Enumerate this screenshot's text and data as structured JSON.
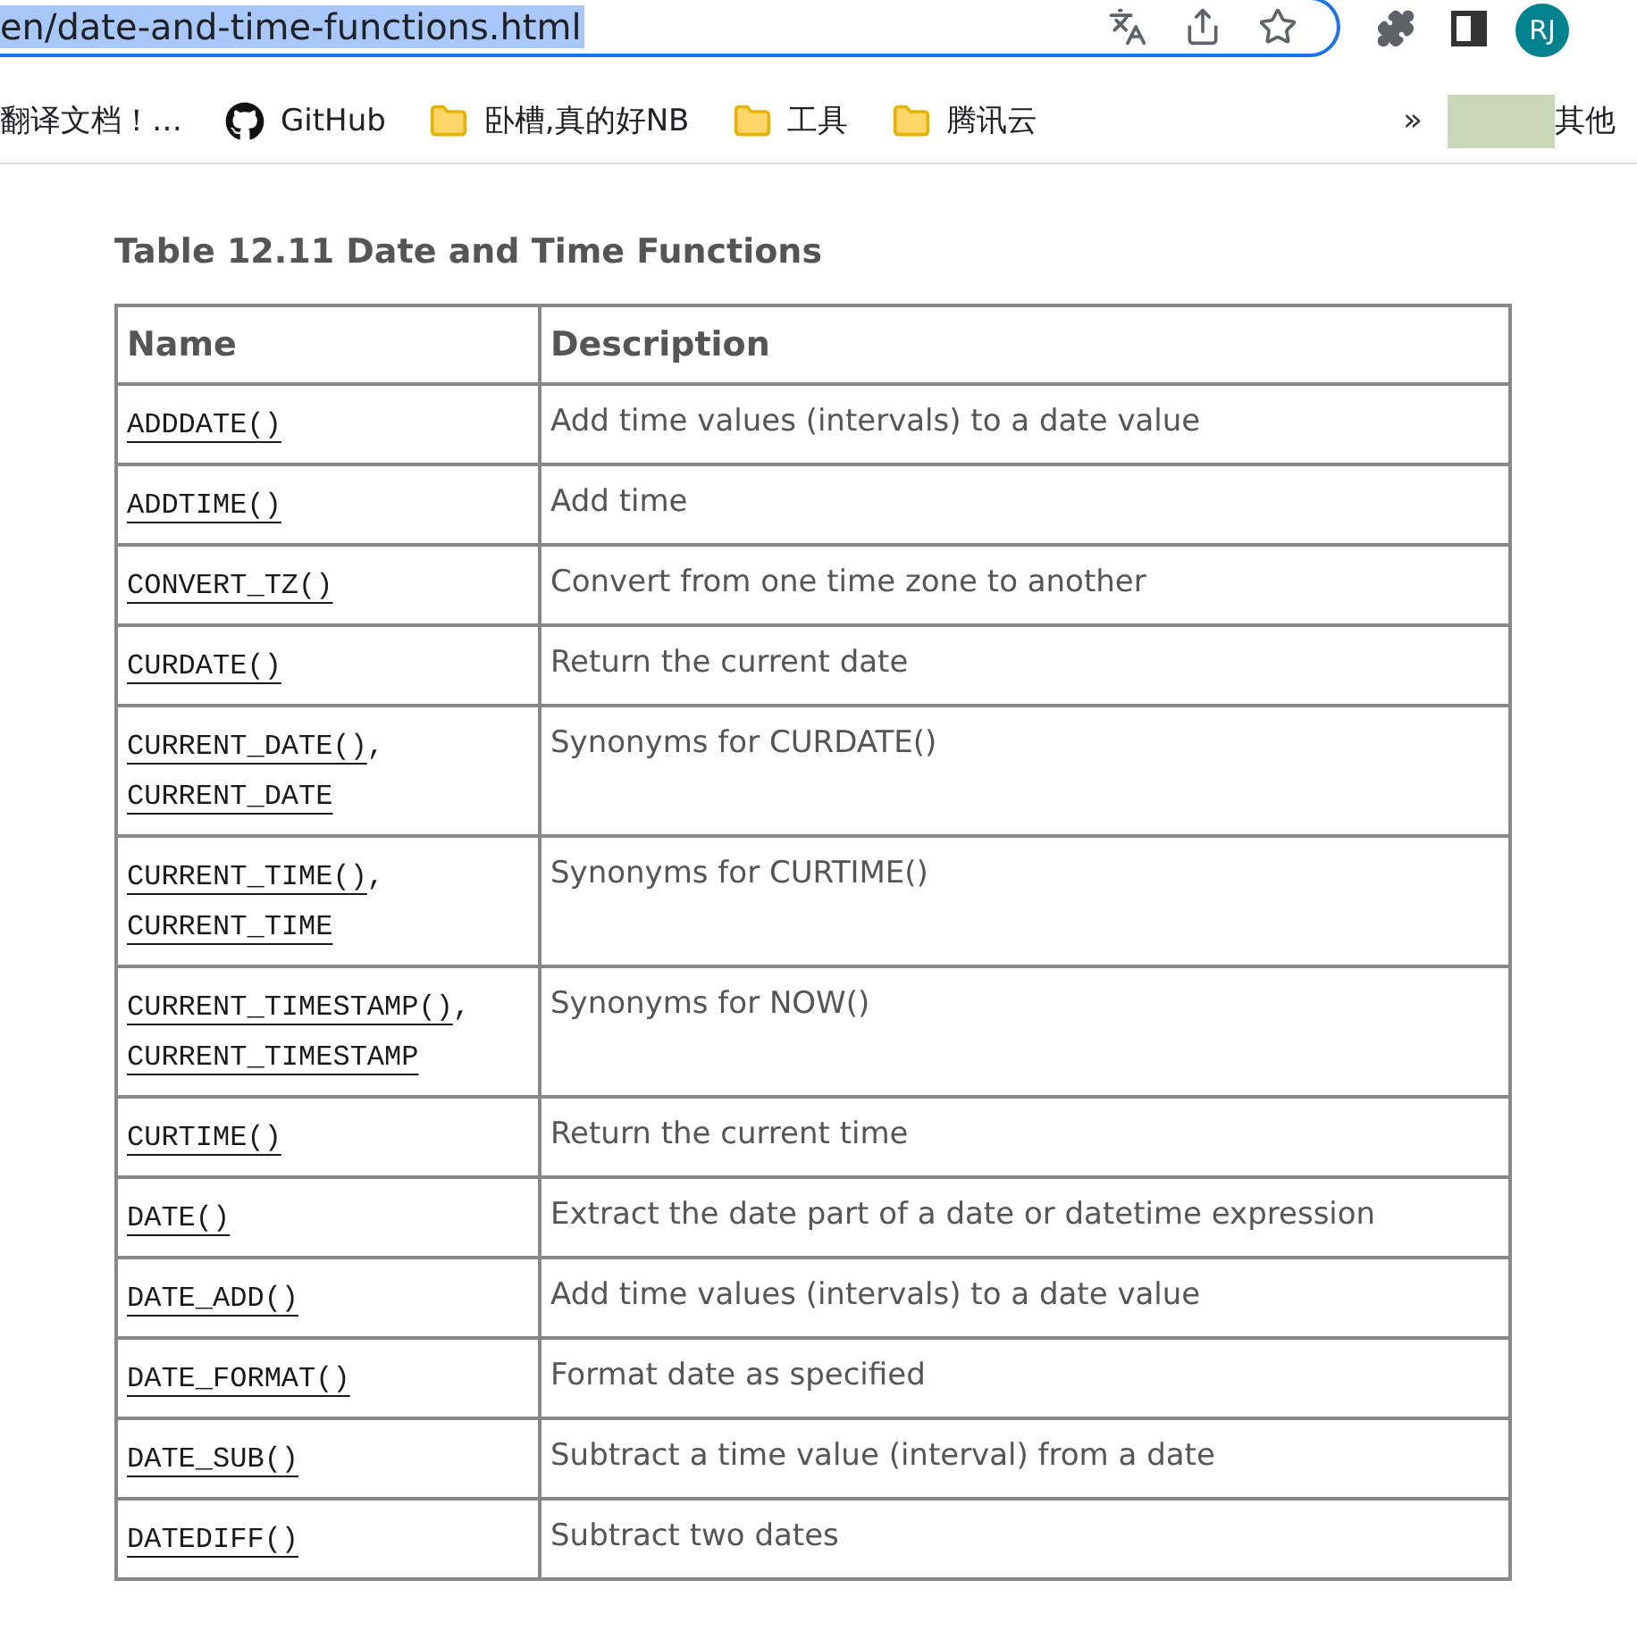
{
  "address_bar": {
    "url": "en/date-and-time-functions.html"
  },
  "profile": {
    "initials": "RJ"
  },
  "bookmarks": [
    {
      "kind": "text",
      "label": "翻译文档！…"
    },
    {
      "kind": "github",
      "label": "GitHub"
    },
    {
      "kind": "folder",
      "label": "卧槽,真的好NB"
    },
    {
      "kind": "folder",
      "label": "工具"
    },
    {
      "kind": "folder",
      "label": "腾讯云"
    }
  ],
  "more_bookmarks": {
    "overflow": "»",
    "label": "其他"
  },
  "table": {
    "caption": "Table 12.11 Date and Time Functions",
    "columns": [
      "Name",
      "Description"
    ],
    "rows": [
      {
        "links": [
          "ADDDATE()"
        ],
        "description": "Add time values (intervals) to a date value"
      },
      {
        "links": [
          "ADDTIME()"
        ],
        "description": "Add time"
      },
      {
        "links": [
          "CONVERT_TZ()"
        ],
        "description": "Convert from one time zone to another"
      },
      {
        "links": [
          "CURDATE()"
        ],
        "description": "Return the current date"
      },
      {
        "links": [
          "CURRENT_DATE()",
          "CURRENT_DATE"
        ],
        "separator": ",",
        "description": "Synonyms for CURDATE()"
      },
      {
        "links": [
          "CURRENT_TIME()",
          "CURRENT_TIME"
        ],
        "separator": ",",
        "description": "Synonyms for CURTIME()"
      },
      {
        "links": [
          "CURRENT_TIMESTAMP()",
          "CURRENT_TIMESTAMP"
        ],
        "separator": ",",
        "description": "Synonyms for NOW()"
      },
      {
        "links": [
          "CURTIME()"
        ],
        "description": "Return the current time"
      },
      {
        "links": [
          "DATE()"
        ],
        "description": "Extract the date part of a date or datetime expression"
      },
      {
        "links": [
          "DATE_ADD()"
        ],
        "description": "Add time values (intervals) to a date value"
      },
      {
        "links": [
          "DATE_FORMAT()"
        ],
        "description": "Format date as specified"
      },
      {
        "links": [
          "DATE_SUB()"
        ],
        "description": "Subtract a time value (interval) from a date"
      },
      {
        "links": [
          "DATEDIFF()"
        ],
        "description": "Subtract two dates"
      }
    ]
  }
}
